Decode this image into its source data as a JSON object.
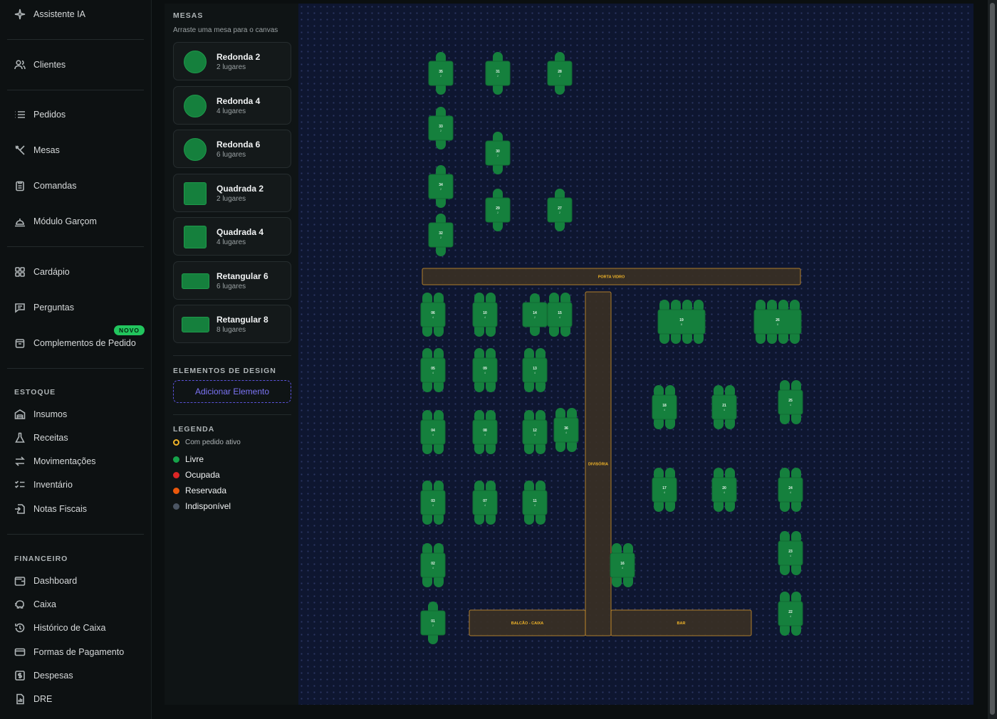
{
  "sidebar": {
    "items": [
      {
        "label": "Assistente IA",
        "icon": "sparkle-icon"
      },
      {
        "label": "Clientes",
        "icon": "users-icon"
      },
      {
        "label": "Pedidos",
        "icon": "list-icon"
      },
      {
        "label": "Mesas",
        "icon": "utensils-icon"
      },
      {
        "label": "Comandas",
        "icon": "clipboard-icon"
      },
      {
        "label": "Módulo Garçom",
        "icon": "cloche-icon"
      },
      {
        "label": "Cardápio",
        "icon": "grid-icon"
      },
      {
        "label": "Perguntas",
        "icon": "message-icon"
      },
      {
        "label": "Complementos de Pedido",
        "icon": "box-icon",
        "badge": "NOVO"
      }
    ],
    "estoque_label": "ESTOQUE",
    "estoque": [
      {
        "label": "Insumos",
        "icon": "warehouse-icon"
      },
      {
        "label": "Receitas",
        "icon": "flask-icon"
      },
      {
        "label": "Movimentações",
        "icon": "arrows-icon"
      },
      {
        "label": "Inventário",
        "icon": "checklist-icon"
      },
      {
        "label": "Notas Fiscais",
        "icon": "file-import-icon"
      }
    ],
    "financeiro_label": "FINANCEIRO",
    "financeiro": [
      {
        "label": "Dashboard",
        "icon": "wallet-icon"
      },
      {
        "label": "Caixa",
        "icon": "piggy-icon"
      },
      {
        "label": "Histórico de Caixa",
        "icon": "history-icon"
      },
      {
        "label": "Formas de Pagamento",
        "icon": "card-icon"
      },
      {
        "label": "Despesas",
        "icon": "dollar-icon"
      },
      {
        "label": "DRE",
        "icon": "report-icon"
      }
    ]
  },
  "palette": {
    "title": "MESAS",
    "subtitle": "Arraste uma mesa para o canvas",
    "tables": [
      {
        "name": "Redonda 2",
        "cap": "2 lugares",
        "shape": "round"
      },
      {
        "name": "Redonda 4",
        "cap": "4 lugares",
        "shape": "round"
      },
      {
        "name": "Redonda 6",
        "cap": "6 lugares",
        "shape": "round"
      },
      {
        "name": "Quadrada 2",
        "cap": "2 lugares",
        "shape": "square"
      },
      {
        "name": "Quadrada 4",
        "cap": "4 lugares",
        "shape": "square"
      },
      {
        "name": "Retangular 6",
        "cap": "6 lugares",
        "shape": "rect"
      },
      {
        "name": "Retangular 8",
        "cap": "8 lugares",
        "shape": "rect"
      }
    ],
    "design_title": "ELEMENTOS DE DESIGN",
    "add_label": "Adicionar Elemento",
    "legend_title": "LEGENDA",
    "legend": [
      {
        "label": "Com pedido ativo",
        "color": "#f0b429",
        "ring": true
      },
      {
        "label": "Livre",
        "color": "#16a34a"
      },
      {
        "label": "Ocupada",
        "color": "#dc2626"
      },
      {
        "label": "Reservada",
        "color": "#ea580c"
      },
      {
        "label": "Indisponível",
        "color": "#4b5563"
      }
    ]
  },
  "canvas": {
    "colors": {
      "table": "#15803d",
      "table_dark": "#116b33",
      "element_fill": "#3a3024",
      "element_stroke": "#c28a2c",
      "element_text": "#f0b429"
    },
    "elements": [
      {
        "label": "PORTA VIDRO"
      },
      {
        "label": "DIVISÓRIA"
      },
      {
        "label": "BALCÃO - CAIXA"
      },
      {
        "label": "BAR"
      }
    ],
    "tables": [
      {
        "num": "35",
        "seats": "2"
      },
      {
        "num": "31",
        "seats": "2"
      },
      {
        "num": "28",
        "seats": "2"
      },
      {
        "num": "33",
        "seats": "2"
      },
      {
        "num": "30",
        "seats": "2"
      },
      {
        "num": "34",
        "seats": "2"
      },
      {
        "num": "29",
        "seats": "2"
      },
      {
        "num": "27",
        "seats": "2"
      },
      {
        "num": "32",
        "seats": "2"
      },
      {
        "num": "06",
        "seats": "4"
      },
      {
        "num": "10",
        "seats": "4"
      },
      {
        "num": "14",
        "seats": "2"
      },
      {
        "num": "15",
        "seats": "4"
      },
      {
        "num": "19",
        "seats": "8"
      },
      {
        "num": "26",
        "seats": "8"
      },
      {
        "num": "05",
        "seats": "4"
      },
      {
        "num": "09",
        "seats": "4"
      },
      {
        "num": "13",
        "seats": "4"
      },
      {
        "num": "18",
        "seats": "4"
      },
      {
        "num": "21",
        "seats": "4"
      },
      {
        "num": "25",
        "seats": "4"
      },
      {
        "num": "04",
        "seats": "4"
      },
      {
        "num": "08",
        "seats": "4"
      },
      {
        "num": "12",
        "seats": "4"
      },
      {
        "num": "36",
        "seats": "4"
      },
      {
        "num": "03",
        "seats": "4"
      },
      {
        "num": "07",
        "seats": "4"
      },
      {
        "num": "11",
        "seats": "4"
      },
      {
        "num": "17",
        "seats": "4"
      },
      {
        "num": "20",
        "seats": "4"
      },
      {
        "num": "24",
        "seats": "4"
      },
      {
        "num": "23",
        "seats": "4"
      },
      {
        "num": "02",
        "seats": "4"
      },
      {
        "num": "16",
        "seats": "4"
      },
      {
        "num": "22",
        "seats": "4"
      },
      {
        "num": "01",
        "seats": "2"
      }
    ]
  }
}
